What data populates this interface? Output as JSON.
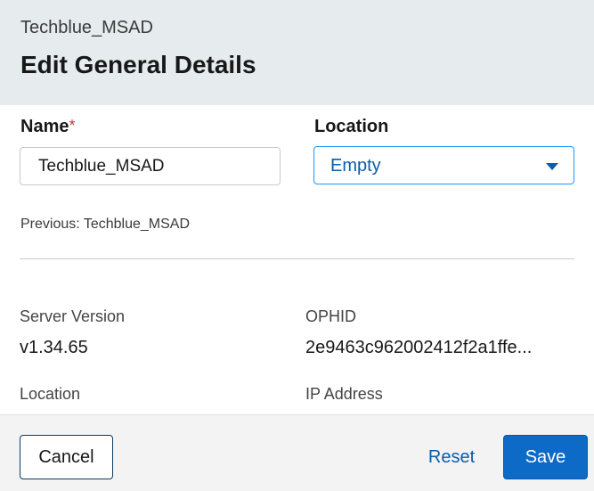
{
  "header": {
    "subtitle": "Techblue_MSAD",
    "title": "Edit General Details"
  },
  "form": {
    "name_label": "Name",
    "required_mark": "*",
    "name_value": "Techblue_MSAD",
    "location_label": "Location",
    "location_value": "Empty",
    "previous_text": "Previous: Techblue_MSAD"
  },
  "info": {
    "server_version_label": "Server Version",
    "server_version_value": "v1.34.65",
    "ophid_label": "OPHID",
    "ophid_value": "2e9463c962002412f2a1ffe...",
    "location_label": "Location",
    "ip_address_label": "IP Address"
  },
  "footer": {
    "cancel_label": "Cancel",
    "reset_label": "Reset",
    "save_label": "Save"
  },
  "colors": {
    "header_bg": "#e6ecee",
    "accent": "#0b5cab",
    "primary_button": "#0d6ac6",
    "required": "#c23934",
    "focus_border": "#1b96ff"
  },
  "icons": {
    "location_caret": "caret-down-icon"
  }
}
